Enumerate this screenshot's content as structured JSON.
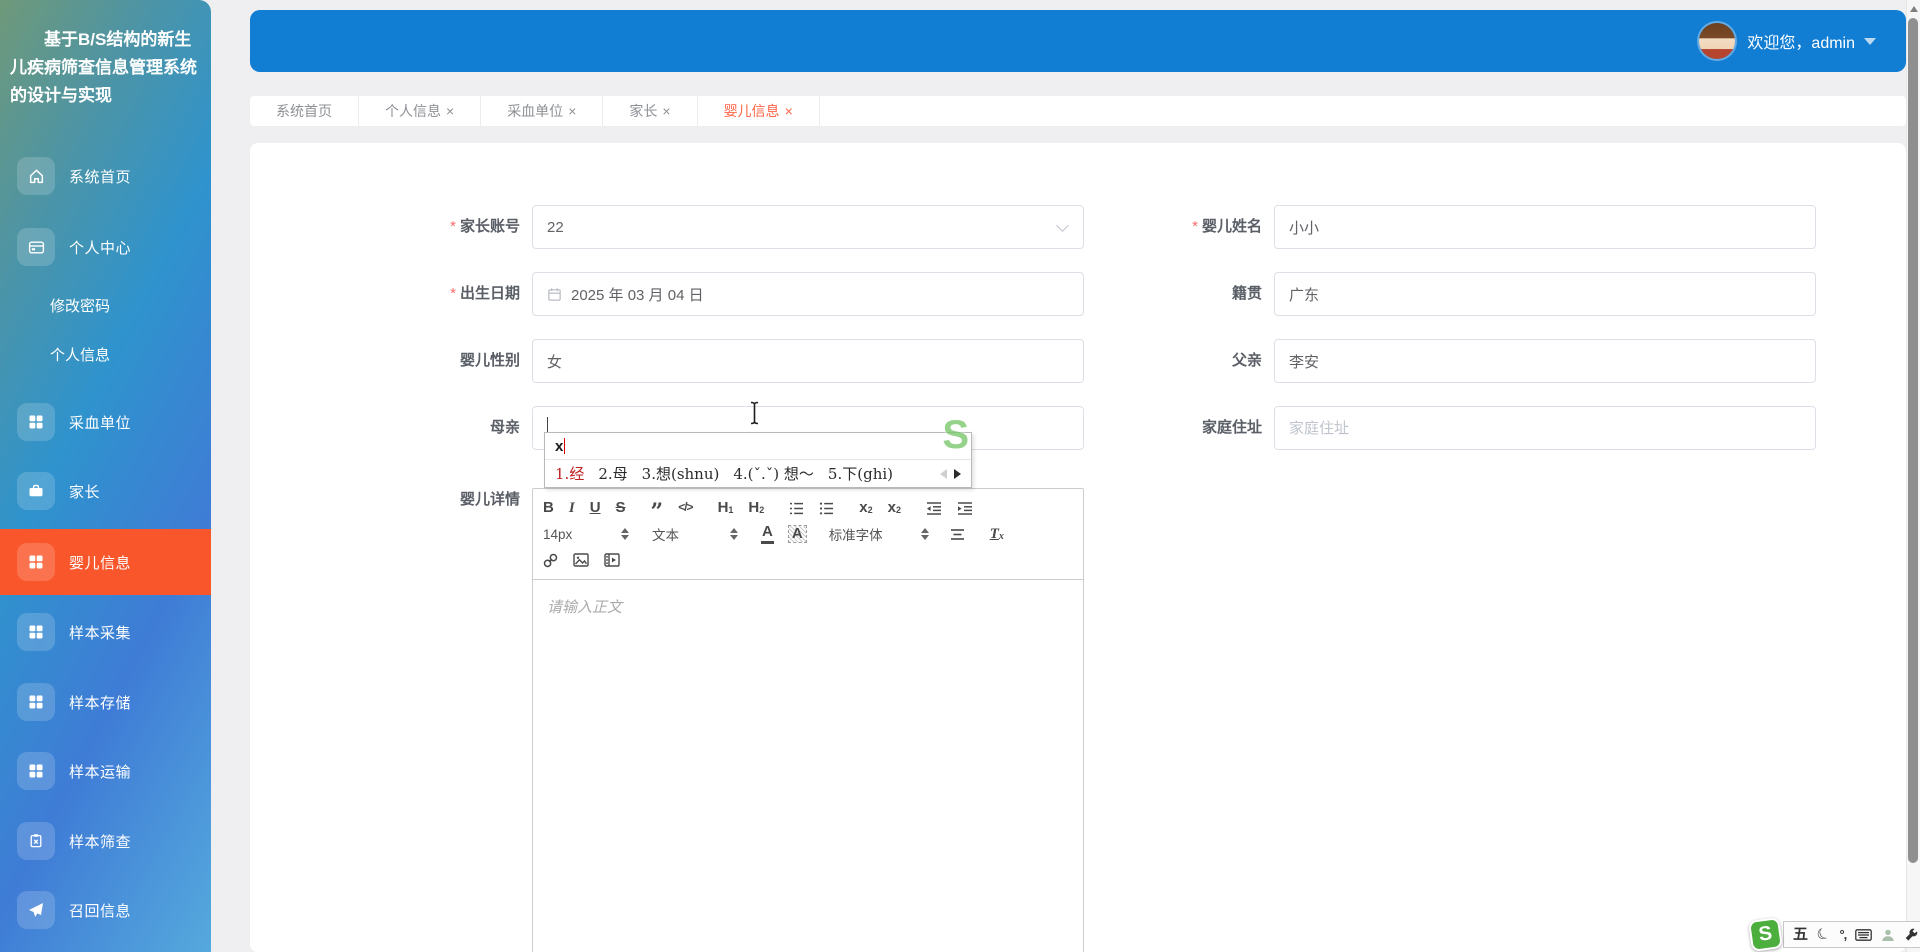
{
  "colors": {
    "header_blue": "#117ed4",
    "sidebar_active_orange": "#f9572b",
    "active_tab_orange": "#ff6448"
  },
  "sidebar": {
    "title": "基于B/S结构的新生儿疾病筛查信息管理系统的设计与实现",
    "items": [
      {
        "label": "系统首页",
        "icon": "home"
      },
      {
        "label": "个人中心",
        "icon": "id-card"
      },
      {
        "label": "修改密码",
        "icon": null
      },
      {
        "label": "个人信息",
        "icon": null
      },
      {
        "label": "采血单位",
        "icon": "grid"
      },
      {
        "label": "家长",
        "icon": "briefcase"
      },
      {
        "label": "婴儿信息",
        "icon": "grid",
        "active": true
      },
      {
        "label": "样本采集",
        "icon": "grid"
      },
      {
        "label": "样本存储",
        "icon": "grid"
      },
      {
        "label": "样本运输",
        "icon": "grid"
      },
      {
        "label": "样本筛查",
        "icon": "clipboard"
      },
      {
        "label": "召回信息",
        "icon": "send"
      }
    ]
  },
  "header": {
    "welcome_prefix": "欢迎您，",
    "username": "admin"
  },
  "tabs": [
    {
      "label": "系统首页",
      "closable": false
    },
    {
      "label": "个人信息",
      "closable": true
    },
    {
      "label": "采血单位",
      "closable": true
    },
    {
      "label": "家长",
      "closable": true
    },
    {
      "label": "婴儿信息",
      "closable": true,
      "active": true
    }
  ],
  "close_glyph": "×",
  "form": {
    "required_mark": "*",
    "parent_account": {
      "label": "家长账号",
      "required": true,
      "type": "select",
      "value": "22"
    },
    "baby_name": {
      "label": "婴儿姓名",
      "required": true,
      "value": "小小"
    },
    "birth_date": {
      "label": "出生日期",
      "required": true,
      "type": "date",
      "value": "2025 年 03 月 04 日"
    },
    "native_place": {
      "label": "籍贯",
      "value": "广东"
    },
    "baby_gender": {
      "label": "婴儿性别",
      "value": "女"
    },
    "father": {
      "label": "父亲",
      "value": "李安"
    },
    "mother": {
      "label": "母亲",
      "value": ""
    },
    "home_address": {
      "label": "家庭住址",
      "value": "",
      "placeholder": "家庭住址"
    },
    "baby_detail": {
      "label": "婴儿详情"
    }
  },
  "ime": {
    "composition": "x",
    "candidates": [
      {
        "num": "1.",
        "text": "经"
      },
      {
        "num": "2.",
        "text": "母"
      },
      {
        "num": "3.",
        "text": "想(shnu)"
      },
      {
        "num": "4.",
        "text": "(ˇ.ˇ) 想～"
      },
      {
        "num": "5.",
        "text": "下(ghi)"
      }
    ],
    "logo": "S"
  },
  "editor": {
    "placeholder": "请输入正文",
    "size_value": "14px",
    "paragraph_value": "文本",
    "font_value": "标准字体",
    "buttons": {
      "bold": "B",
      "italic": "I",
      "underline": "U",
      "strike": "S",
      "quote": "”",
      "code": "</>",
      "h": "H",
      "h1n": "1",
      "h2n": "2",
      "x": "x",
      "subn": "2",
      "supn": "2",
      "clear_t": "T",
      "clear_x": "x",
      "color_a": "A",
      "bg_a": "A"
    }
  },
  "statusbar": {
    "logo": "S",
    "wubi": "五",
    "punct": "°,"
  }
}
